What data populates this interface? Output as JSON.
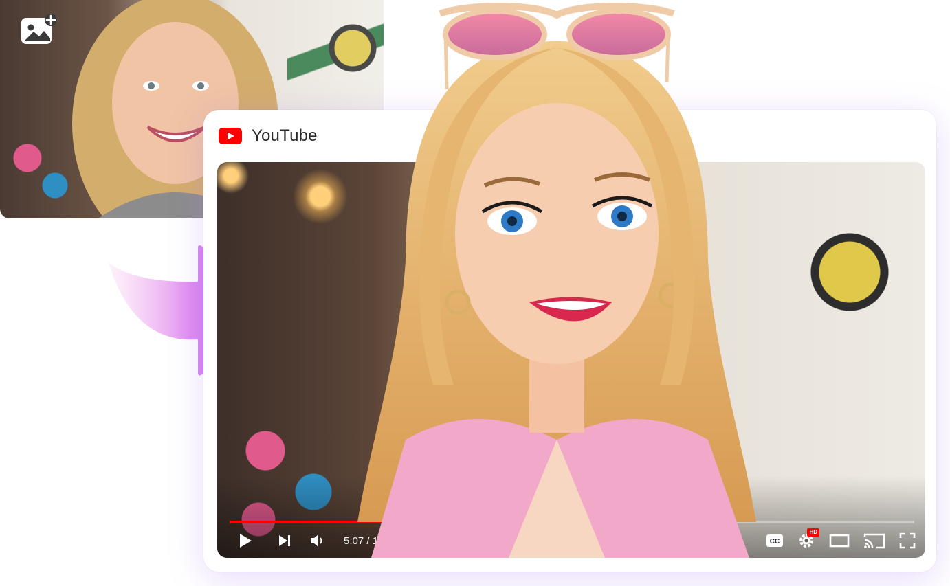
{
  "source": {
    "add_image_icon": "image-add-icon"
  },
  "arrow": {
    "icon": "arrow-right-icon",
    "gradient": [
      "#f7b4e8",
      "#d47af0",
      "#9a5cf0"
    ]
  },
  "player": {
    "brand_label": "YouTube",
    "brand_color": "#ff0000",
    "time_display": "5:07 / 15:28",
    "current_time": "5:07",
    "duration": "15:28",
    "played_fraction": 0.328,
    "buffered_fraction": 0.485,
    "hd_badge": "HD",
    "icons": {
      "play": "play-icon",
      "next": "next-icon",
      "volume": "volume-icon",
      "captions": "captions-icon",
      "settings": "settings-icon",
      "theater": "theater-mode-icon",
      "cast": "cast-icon",
      "fullscreen": "fullscreen-icon"
    }
  }
}
